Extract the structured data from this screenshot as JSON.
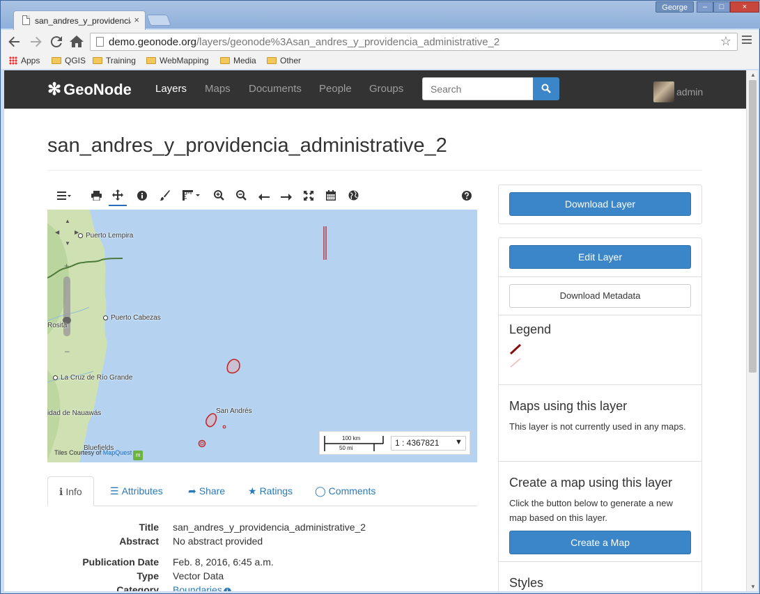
{
  "browser": {
    "tab_title": "san_andres_y_providencia_",
    "tab_close": "×",
    "user_chip": "George",
    "win_min": "–",
    "win_max": "□",
    "win_close": "×",
    "url_host": "demo.geonode.org",
    "url_path": "/layers/geonode%3Asan_andres_y_providencia_administrative_2",
    "bookmarks": [
      "Apps",
      "QGIS",
      "Training",
      "WebMapping",
      "Media",
      "Other"
    ]
  },
  "navbar": {
    "brand": "GeoNode",
    "links": [
      "Layers",
      "Maps",
      "Documents",
      "People",
      "Groups"
    ],
    "active": "Layers",
    "search_placeholder": "Search",
    "user": "admin"
  },
  "page": {
    "title": "san_andres_y_providencia_administrative_2"
  },
  "map": {
    "places": [
      "Puerto Lempira",
      "Puerto Cabezas",
      "Rosita",
      "La Cruz de Río Grande",
      "idad de Nauawás",
      "San Andrés",
      "Bluefields"
    ],
    "attribution_prefix": "Tiles Courtesy of ",
    "attribution_link": "MapQuest",
    "attribution_logo": "m",
    "scale_km": "100 km",
    "scale_mi": "50 mi",
    "scale_value": "1 : 4367821",
    "zoom_plus": "+",
    "zoom_minus": "–"
  },
  "tabs": [
    {
      "label": "Info",
      "icon": "info-icon"
    },
    {
      "label": "Attributes",
      "icon": "list-icon"
    },
    {
      "label": "Share",
      "icon": "share-icon"
    },
    {
      "label": "Ratings",
      "icon": "star-icon"
    },
    {
      "label": "Comments",
      "icon": "comment-icon"
    }
  ],
  "info": {
    "title_label": "Title",
    "title_value": "san_andres_y_providencia_administrative_2",
    "abstract_label": "Abstract",
    "abstract_value": "No abstract provided",
    "pubdate_label": "Publication Date",
    "pubdate_value": "Feb. 8, 2016, 6:45 a.m.",
    "type_label": "Type",
    "type_value": "Vector Data",
    "category_label": "Category",
    "category_value": "Boundaries"
  },
  "sidebar": {
    "download_layer": "Download Layer",
    "edit_layer": "Edit Layer",
    "download_metadata": "Download Metadata",
    "legend_title": "Legend",
    "maps_using_title": "Maps using this layer",
    "maps_using_text": "This layer is not currently used in any maps.",
    "create_map_title": "Create a map using this layer",
    "create_map_text": "Click the button below to generate a new map based on this layer.",
    "create_map_button": "Create a Map",
    "styles_title": "Styles"
  },
  "colors": {
    "navbar_bg": "#333333",
    "primary": "#3a86c8",
    "link": "#2a7ab8",
    "map_water": "#b5d3f0",
    "layer_stroke": "#c0282d"
  }
}
